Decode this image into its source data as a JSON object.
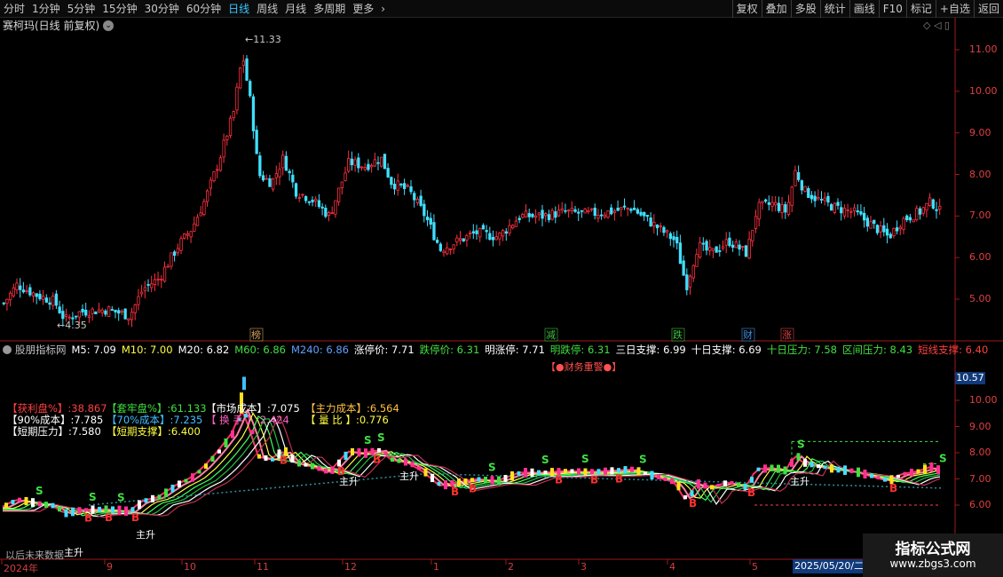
{
  "toolbar": {
    "left_tabs": [
      {
        "label": "分时",
        "active": false
      },
      {
        "label": "1分钟",
        "active": false
      },
      {
        "label": "5分钟",
        "active": false
      },
      {
        "label": "15分钟",
        "active": false
      },
      {
        "label": "30分钟",
        "active": false
      },
      {
        "label": "60分钟",
        "active": false
      },
      {
        "label": "日线",
        "active": true
      },
      {
        "label": "周线",
        "active": false
      },
      {
        "label": "月线",
        "active": false
      },
      {
        "label": "多周期",
        "active": false
      },
      {
        "label": "更多",
        "active": false
      }
    ],
    "more_chevron": "›",
    "right_buttons": [
      "复权",
      "叠加",
      "多股",
      "统计",
      "画线",
      "F10",
      "标记",
      "+自选",
      "返回"
    ]
  },
  "stock": {
    "title": "赛柯玛(日线 前复权)",
    "chevron": "⌄",
    "corner_icons": "◇ ◁ ▯"
  },
  "price_axis": {
    "ticks": [
      "11.00",
      "10.00",
      "9.00",
      "8.00",
      "7.00",
      "6.00",
      "5.00"
    ],
    "high_label": "11.33",
    "low_label": "4.35"
  },
  "event_markers": [
    {
      "label": "榜",
      "color": "#d4a15a"
    },
    {
      "label": "减",
      "color": "#40c040"
    },
    {
      "label": "跌",
      "color": "#40c040"
    },
    {
      "label": "财",
      "color": "#4090e0"
    },
    {
      "label": "涨",
      "color": "#e04040"
    }
  ],
  "indicator_header": [
    {
      "text": "股朋指标网",
      "color": "#c0c0c0"
    },
    {
      "text": "M5: 7.09",
      "color": "#ffffff"
    },
    {
      "text": "M10: 7.00",
      "color": "#ffff40"
    },
    {
      "text": "M20: 6.82",
      "color": "#ffffff"
    },
    {
      "text": "M60: 6.86",
      "color": "#40e040"
    },
    {
      "text": "M240: 6.86",
      "color": "#60a0ff"
    },
    {
      "text": "涨停价: 7.71",
      "color": "#ffffff"
    },
    {
      "text": "跌停价: 6.31",
      "color": "#40e040"
    },
    {
      "text": "明涨停: 7.71",
      "color": "#ffffff"
    },
    {
      "text": "明跌停: 6.31",
      "color": "#40e040"
    },
    {
      "text": "三日支撑: 6.99",
      "color": "#ffffff"
    },
    {
      "text": "十日支撑: 6.69",
      "color": "#ffffff"
    },
    {
      "text": "十日压力: 7.58",
      "color": "#40e040"
    },
    {
      "text": "区间压力: 8.43",
      "color": "#40e040"
    },
    {
      "text": "短线支撑: 6.40",
      "color": "#ff4040"
    }
  ],
  "finance_warning": "【●财务重警●】",
  "legend": {
    "rows": [
      [
        {
          "text": "【获利盘%】:38.867",
          "color": "#ff4040"
        },
        {
          "text": "【套牢盘%】:61.133",
          "color": "#40e040"
        },
        {
          "text": "【市场成本】:7.075",
          "color": "#ffffff"
        },
        {
          "text": "【主力成本】:6.564",
          "color": "#ffc040"
        }
      ],
      [
        {
          "text": "【90%成本】:7.785",
          "color": "#ffffff"
        },
        {
          "text": "【70%成本】:7.235",
          "color": "#40c0ff"
        },
        {
          "text": "【 换 手 】:2.424",
          "color": "#ff60c0"
        },
        {
          "text": "【 量 比 】:0.776",
          "color": "#ffff40"
        }
      ],
      [
        {
          "text": "【短期压力】:7.580",
          "color": "#ffffff"
        },
        {
          "text": "【短期支撑】:6.400",
          "color": "#ffff40"
        }
      ]
    ]
  },
  "lower_axis": {
    "ticks": [
      "10.00",
      "9.00",
      "8.00",
      "7.00",
      "6.00"
    ],
    "current_price": "10.57"
  },
  "signals": {
    "buy": "B",
    "sell": "S",
    "main_rise": "主升"
  },
  "date_axis": {
    "labels": [
      "2024年",
      "9",
      "10",
      "11",
      "12",
      "1",
      "2",
      "3",
      "4",
      "5"
    ],
    "current_date": "2025/05/20/二"
  },
  "no_future_data": "以后未来数据",
  "watermark": {
    "title": "指标公式网",
    "url": "www.zbgs3.com"
  },
  "colors": {
    "up": "#ff3040",
    "down": "#40e0ff",
    "axis": "#c02020",
    "background": "#000000"
  }
}
